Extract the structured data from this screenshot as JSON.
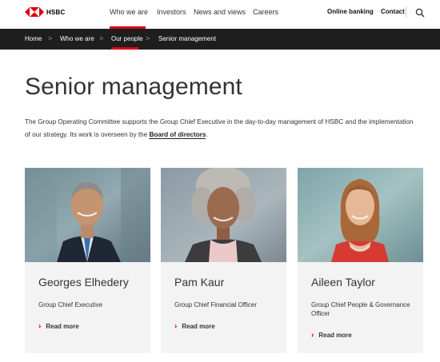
{
  "header": {
    "brand": "HSBC",
    "nav": [
      {
        "label": "Who we are"
      },
      {
        "label": "Investors"
      },
      {
        "label": "News and views"
      },
      {
        "label": "Careers"
      }
    ],
    "online_banking": "Online banking",
    "contact": "Contact",
    "search_icon": "search-icon"
  },
  "breadcrumb": {
    "items": [
      "Home",
      "Who we are",
      "Our people",
      "Senior management"
    ],
    "separator": ">"
  },
  "page": {
    "title": "Senior management",
    "intro_text": "The Group Operating Committee supports the Group Chief Executive in the day-to-day management of HSBC and the implementation of our strategy. Its work is overseen by the ",
    "intro_link": "Board of directors",
    "intro_end": "."
  },
  "cards": [
    {
      "name": "Georges Elhedery",
      "role": "Group Chief Executive",
      "cta": "Read more"
    },
    {
      "name": "Pam Kaur",
      "role": "Group Chief Financial Officer",
      "cta": "Read more"
    },
    {
      "name": "Aileen Taylor",
      "role": "Group Chief People & Governance Officer",
      "cta": "Read more"
    }
  ],
  "colors": {
    "accent": "#db0011",
    "breadcrumb_bg": "#1e1e1e",
    "card_bg": "#f3f3f3"
  }
}
